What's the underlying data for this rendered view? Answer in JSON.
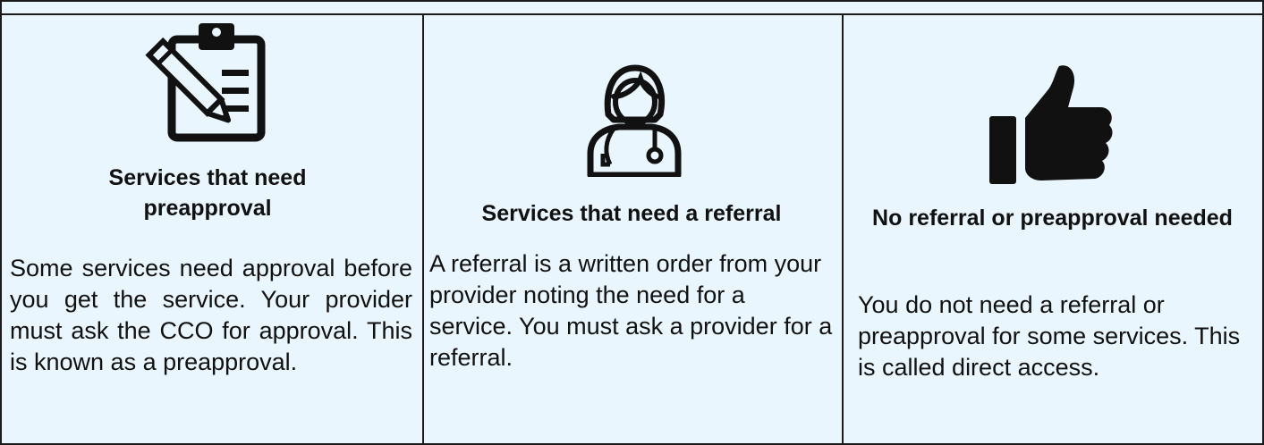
{
  "columns": [
    {
      "icon": "clipboard-pencil-icon",
      "title": "Services that need preapproval",
      "body": "Some services need approval before you get the service. Your provider must ask the CCO for approval. This is known as a preapproval."
    },
    {
      "icon": "doctor-stethoscope-icon",
      "title": "Services that need a referral",
      "body": "A referral is a written order from your provider noting the need for a service. You must ask a provider for a referral."
    },
    {
      "icon": "thumbs-up-icon",
      "title": "No referral or preapproval needed",
      "body": "You do not need a referral or preapproval for some services. This is called direct access."
    }
  ],
  "colors": {
    "background": "#e9f6fd",
    "border": "#1a1a1a",
    "icon": "#111111"
  }
}
